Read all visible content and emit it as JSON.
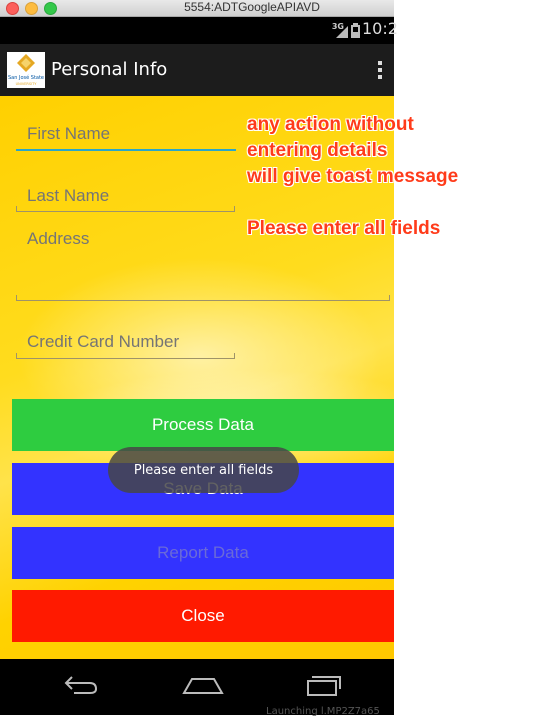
{
  "window": {
    "title": "5554:ADTGoogleAPIAVD"
  },
  "status_bar": {
    "network": "3G",
    "time": "10:2"
  },
  "action_bar": {
    "title": "Personal Info",
    "logo_lines": [
      "San José State",
      "UNIVERSITY"
    ]
  },
  "form": {
    "first_name_placeholder": "First Name",
    "last_name_placeholder": "Last Name",
    "address_placeholder": "Address",
    "credit_card_placeholder": "Credit Card Number"
  },
  "buttons": {
    "process": "Process Data",
    "save": "Save Data",
    "report": "Report Data",
    "close": "Close"
  },
  "colors": {
    "process": "#2ecc40",
    "save": "#3333ff",
    "report": "#3333ff",
    "close": "#ff1a00",
    "annotation": "#ff3b1a"
  },
  "toast": {
    "message": "Please enter all fields"
  },
  "annotation": {
    "lines": [
      "any action without",
      "entering details",
      "will give toast message"
    ],
    "note": "Please enter all fields"
  },
  "terminal_fragment": "Launching l.MP2Z7a65"
}
